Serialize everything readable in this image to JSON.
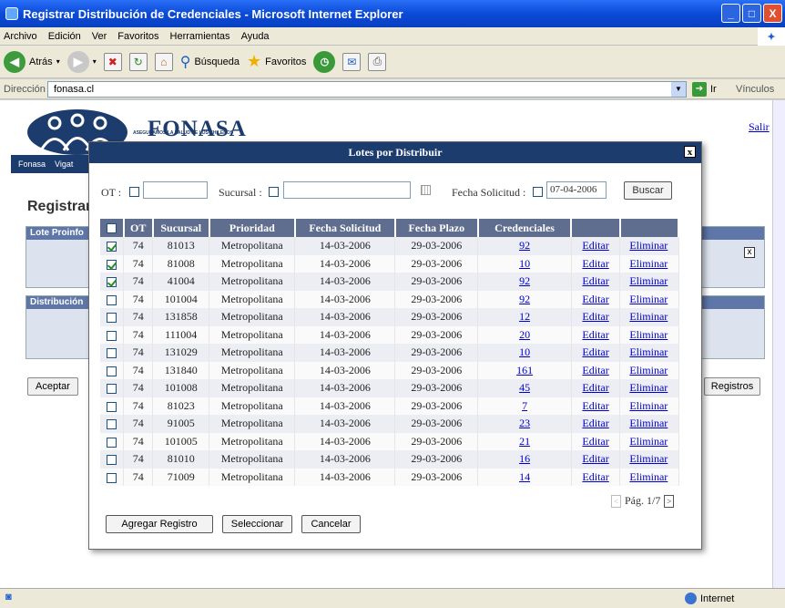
{
  "window": {
    "title": "Registrar Distribución de Credenciales - Microsoft Internet Explorer",
    "btn_min": "_",
    "btn_max": "□",
    "btn_close": "X"
  },
  "menu": {
    "items": [
      "Archivo",
      "Edición",
      "Ver",
      "Favoritos",
      "Herramientas",
      "Ayuda"
    ]
  },
  "toolbar": {
    "back": "Atrás",
    "search": "Búsqueda",
    "favorites": "Favoritos"
  },
  "address": {
    "label": "Dirección",
    "value": "fonasa.cl",
    "go": "Ir",
    "links": "Vínculos"
  },
  "status": {
    "zone": "Internet"
  },
  "page": {
    "logo_text": "FONASA",
    "logo_sub": "ASEGURAMOS LA SALUD DE LOS CHILENOS",
    "salir": "Salir",
    "nav": [
      "Fonasa",
      "Vigat"
    ],
    "title": "Registrar",
    "panel1": "Lote Proinfo",
    "panel2": "Distribución",
    "aceptar": "Aceptar",
    "registros": "Registros",
    "panel_close": "x"
  },
  "modal": {
    "title": "Lotes por Distribuir",
    "close": "x",
    "ot_label": "OT :",
    "sucursal_label": "Sucursal :",
    "fecha_label": "Fecha Solicitud :",
    "fecha_value": "07-04-2006",
    "buscar": "Buscar",
    "columns": [
      "OT",
      "Sucursal",
      "Prioridad",
      "Fecha Solicitud",
      "Fecha Plazo",
      "Credenciales"
    ],
    "rows": [
      {
        "checked": true,
        "ot": "74",
        "sucursal": "81013",
        "prioridad": "Metropolitana",
        "fs": "14-03-2006",
        "fp": "29-03-2006",
        "cred": "92"
      },
      {
        "checked": true,
        "ot": "74",
        "sucursal": "81008",
        "prioridad": "Metropolitana",
        "fs": "14-03-2006",
        "fp": "29-03-2006",
        "cred": "10"
      },
      {
        "checked": true,
        "ot": "74",
        "sucursal": "41004",
        "prioridad": "Metropolitana",
        "fs": "14-03-2006",
        "fp": "29-03-2006",
        "cred": "92"
      },
      {
        "checked": false,
        "ot": "74",
        "sucursal": "101004",
        "prioridad": "Metropolitana",
        "fs": "14-03-2006",
        "fp": "29-03-2006",
        "cred": "92"
      },
      {
        "checked": false,
        "ot": "74",
        "sucursal": "131858",
        "prioridad": "Metropolitana",
        "fs": "14-03-2006",
        "fp": "29-03-2006",
        "cred": "12"
      },
      {
        "checked": false,
        "ot": "74",
        "sucursal": "111004",
        "prioridad": "Metropolitana",
        "fs": "14-03-2006",
        "fp": "29-03-2006",
        "cred": "20"
      },
      {
        "checked": false,
        "ot": "74",
        "sucursal": "131029",
        "prioridad": "Metropolitana",
        "fs": "14-03-2006",
        "fp": "29-03-2006",
        "cred": "10"
      },
      {
        "checked": false,
        "ot": "74",
        "sucursal": "131840",
        "prioridad": "Metropolitana",
        "fs": "14-03-2006",
        "fp": "29-03-2006",
        "cred": "161"
      },
      {
        "checked": false,
        "ot": "74",
        "sucursal": "101008",
        "prioridad": "Metropolitana",
        "fs": "14-03-2006",
        "fp": "29-03-2006",
        "cred": "45"
      },
      {
        "checked": false,
        "ot": "74",
        "sucursal": "81023",
        "prioridad": "Metropolitana",
        "fs": "14-03-2006",
        "fp": "29-03-2006",
        "cred": "7"
      },
      {
        "checked": false,
        "ot": "74",
        "sucursal": "91005",
        "prioridad": "Metropolitana",
        "fs": "14-03-2006",
        "fp": "29-03-2006",
        "cred": "23"
      },
      {
        "checked": false,
        "ot": "74",
        "sucursal": "101005",
        "prioridad": "Metropolitana",
        "fs": "14-03-2006",
        "fp": "29-03-2006",
        "cred": "21"
      },
      {
        "checked": false,
        "ot": "74",
        "sucursal": "81010",
        "prioridad": "Metropolitana",
        "fs": "14-03-2006",
        "fp": "29-03-2006",
        "cred": "16"
      },
      {
        "checked": false,
        "ot": "74",
        "sucursal": "71009",
        "prioridad": "Metropolitana",
        "fs": "14-03-2006",
        "fp": "29-03-2006",
        "cred": "14"
      }
    ],
    "editar": "Editar",
    "eliminar": "Eliminar",
    "pager": "Pág. 1/7",
    "pager_prev": "<",
    "pager_next": ">",
    "agregar": "Agregar Registro",
    "seleccionar": "Seleccionar",
    "cancelar": "Cancelar"
  }
}
